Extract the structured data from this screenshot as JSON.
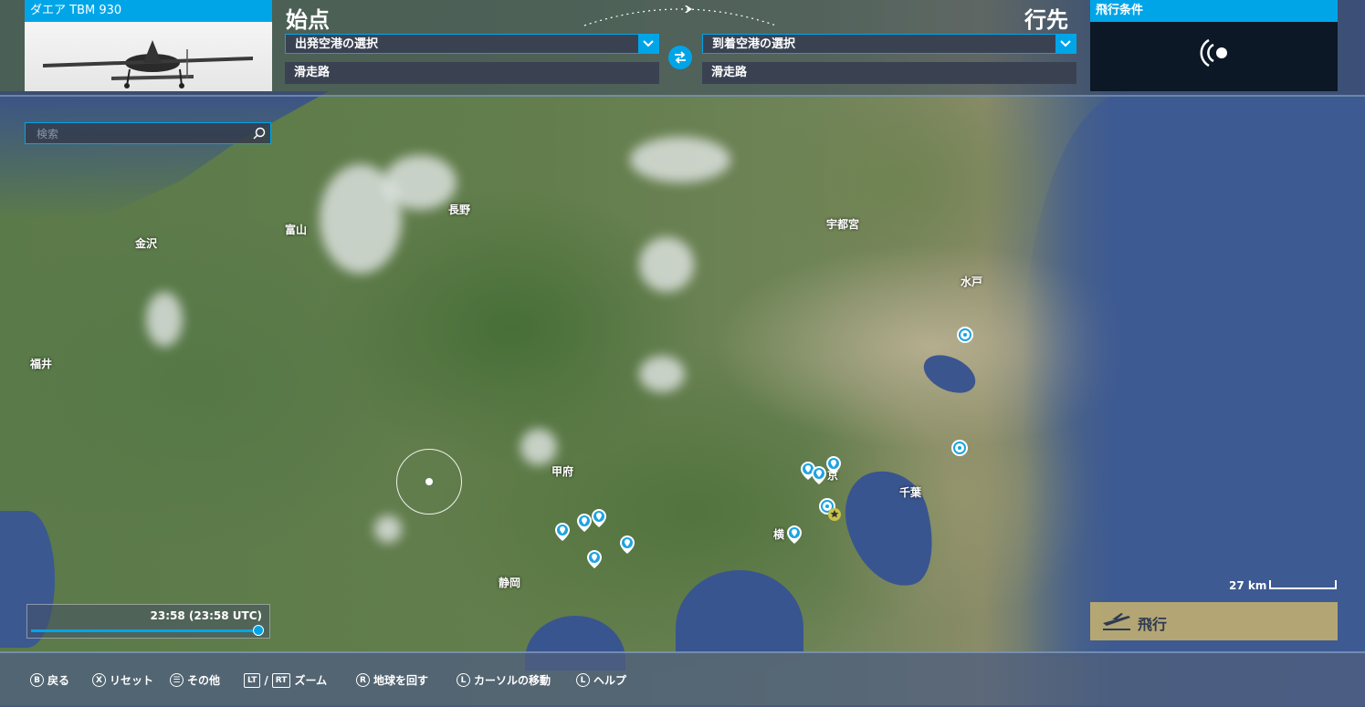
{
  "aircraft": {
    "name": "ダエア TBM 930"
  },
  "departure": {
    "title": "始点",
    "airport_placeholder": "出発空港の選択",
    "runway": "滑走路"
  },
  "arrival": {
    "title": "行先",
    "airport_placeholder": "到着空港の選択",
    "runway": "滑走路"
  },
  "conditions": {
    "title": "飛行条件"
  },
  "search": {
    "placeholder": "検索"
  },
  "cities": {
    "kanazawa": "金沢",
    "toyama": "富山",
    "nagano": "長野",
    "utsunomiya": "宇都宮",
    "mito": "水戸",
    "fukui": "福井",
    "kofu": "甲府",
    "chiba": "千葉",
    "shizuoka": "静岡",
    "yokohama": "横",
    "tokyo_partial": "京"
  },
  "time": {
    "display": "23:58 (23:58 UTC)",
    "progress": 0.99
  },
  "scale": {
    "label": "27 km"
  },
  "fly": {
    "label": "飛行"
  },
  "hints": [
    {
      "key": "B",
      "label": "戻る",
      "icon_type": "circle"
    },
    {
      "key": "X",
      "label": "リセット",
      "icon_type": "circle"
    },
    {
      "key": "☰",
      "label": "その他",
      "icon_type": "circle"
    },
    {
      "key": "LT",
      "label": "/",
      "icon_type": "rect"
    },
    {
      "key": "RT",
      "label": "ズーム",
      "icon_type": "rect"
    },
    {
      "key": "R",
      "label": "地球を回す",
      "icon_type": "circle"
    },
    {
      "key": "L",
      "label": "カーソルの移動",
      "icon_type": "circle"
    },
    {
      "key": "L",
      "label": "ヘルプ",
      "icon_type": "circle"
    }
  ],
  "colors": {
    "accent": "#00a5e8",
    "panel": "#3a4252",
    "fly": "#c8b46e"
  },
  "icons": {
    "dropdown": "chevron-down-icon",
    "swap": "swap-icon",
    "search": "search-icon",
    "airport": "airport-pin-icon",
    "target": "target-icon",
    "plane": "plane-takeoff-icon",
    "wind": "signal-icon"
  }
}
